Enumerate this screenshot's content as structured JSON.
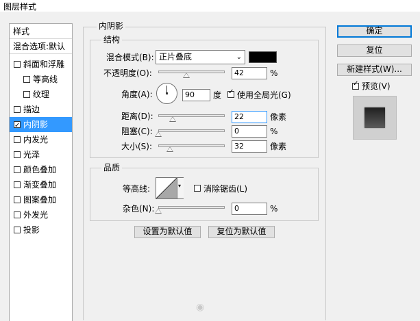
{
  "window": {
    "title": "图层样式"
  },
  "left_panel": {
    "header": "样式",
    "blend_default": "混合选项:默认",
    "items": [
      {
        "label": "斜面和浮雕",
        "checked": false
      },
      {
        "label": "等高线",
        "checked": false
      },
      {
        "label": "纹理",
        "checked": false
      },
      {
        "label": "描边",
        "checked": false
      },
      {
        "label": "内阴影",
        "checked": true
      },
      {
        "label": "内发光",
        "checked": false
      },
      {
        "label": "光泽",
        "checked": false
      },
      {
        "label": "颜色叠加",
        "checked": false
      },
      {
        "label": "渐变叠加",
        "checked": false
      },
      {
        "label": "图案叠加",
        "checked": false
      },
      {
        "label": "外发光",
        "checked": false
      },
      {
        "label": "投影",
        "checked": false
      }
    ]
  },
  "inner_shadow": {
    "title": "内阴影",
    "structure": {
      "title": "结构",
      "blend_mode_label": "混合模式(B):",
      "blend_mode_value": "正片叠底",
      "color": "#000000",
      "opacity_label": "不透明度(O):",
      "opacity_value": "42",
      "opacity_unit": "%",
      "opacity_level": 0.42,
      "angle_label": "角度(A):",
      "angle_value": "90",
      "angle_unit": "度",
      "global_light_label": "使用全局光(G)",
      "global_light_checked": true,
      "distance_label": "距离(D):",
      "distance_value": "22",
      "distance_unit": "像素",
      "distance_level": 0.22,
      "choke_label": "阻塞(C):",
      "choke_value": "0",
      "choke_unit": "%",
      "choke_level": 0,
      "size_label": "大小(S):",
      "size_value": "32",
      "size_unit": "像素",
      "size_level": 0.18
    },
    "quality": {
      "title": "品质",
      "contour_label": "等高线:",
      "antialias_label": "消除锯齿(L)",
      "antialias_checked": false,
      "noise_label": "杂色(N):",
      "noise_value": "0",
      "noise_unit": "%",
      "noise_level": 0
    },
    "make_default": "设置为默认值",
    "reset_default": "复位为默认值"
  },
  "right_panel": {
    "ok": "确定",
    "reset": "复位",
    "new_style": "新建样式(W)...",
    "preview_label": "预览(V)",
    "preview_checked": true
  }
}
